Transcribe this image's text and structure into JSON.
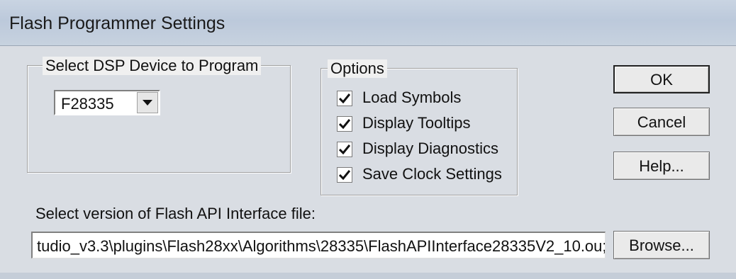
{
  "window": {
    "title": "Flash Programmer Settings"
  },
  "device_group": {
    "legend": "Select DSP Device to Program",
    "selected": "F28335"
  },
  "options_group": {
    "legend": "Options",
    "items": [
      {
        "label": "Load Symbols",
        "checked": true
      },
      {
        "label": "Display Tooltips",
        "checked": true
      },
      {
        "label": "Display Diagnostics",
        "checked": true
      },
      {
        "label": "Save Clock Settings",
        "checked": true
      }
    ]
  },
  "buttons": {
    "ok": "OK",
    "cancel": "Cancel",
    "help": "Help...",
    "browse": "Browse..."
  },
  "api_file": {
    "label": "Select version of Flash API Interface file:",
    "value": "tudio_v3.3\\plugins\\Flash28xx\\Algorithms\\28335\\FlashAPIInterface28335V2_10.ou;"
  },
  "icons": {
    "dropdown": "chevron-down-icon",
    "check": "checkmark-icon"
  }
}
